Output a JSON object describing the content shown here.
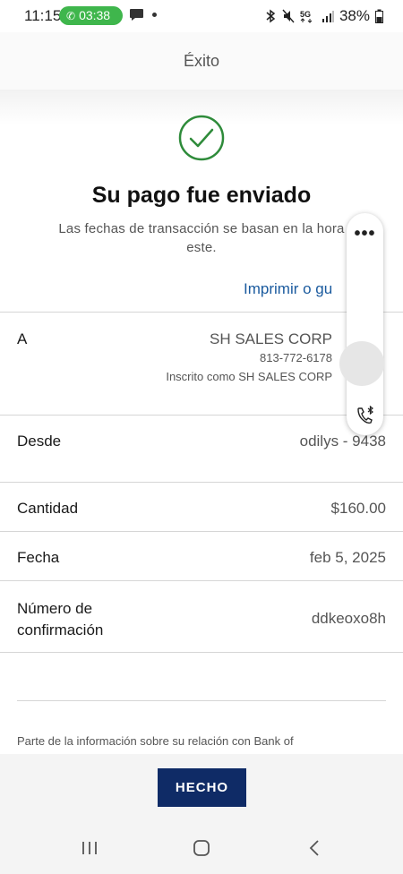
{
  "status_bar": {
    "time": "11:15",
    "call_timer": "03:38",
    "battery": "38%",
    "icons": [
      "message-icon",
      "bluetooth-icon",
      "mute-icon",
      "5g-icon",
      "signal-icon",
      "battery-icon"
    ],
    "call_color": "#3fb64c"
  },
  "header": {
    "title": "Éxito"
  },
  "success": {
    "title": "Su pago fue enviado",
    "subtitle_line1": "Las fechas de transacción se basan en la hora",
    "subtitle_line2": "este.",
    "print_link": "Imprimir o gu",
    "check_color": "#2e8b3a"
  },
  "details": {
    "to": {
      "label": "A",
      "name": "SH SALES CORP",
      "phone": "813-772-6178",
      "registered": "Inscrito como SH SALES CORP"
    },
    "from": {
      "label": "Desde",
      "value": "odilys - 9438"
    },
    "amount": {
      "label": "Cantidad",
      "value": "$160.00"
    },
    "date": {
      "label": "Fecha",
      "value": "feb 5, 2025"
    },
    "confirmation": {
      "label_line1": "Número de",
      "label_line2": "confirmación",
      "value": "ddkeoxo8h"
    }
  },
  "disclaimer": "Parte de la información sobre su relación con Bank of",
  "actions": {
    "done_label": "HECHO",
    "button_color": "#0f2b66"
  },
  "side_bubble": {
    "more": "•••"
  }
}
